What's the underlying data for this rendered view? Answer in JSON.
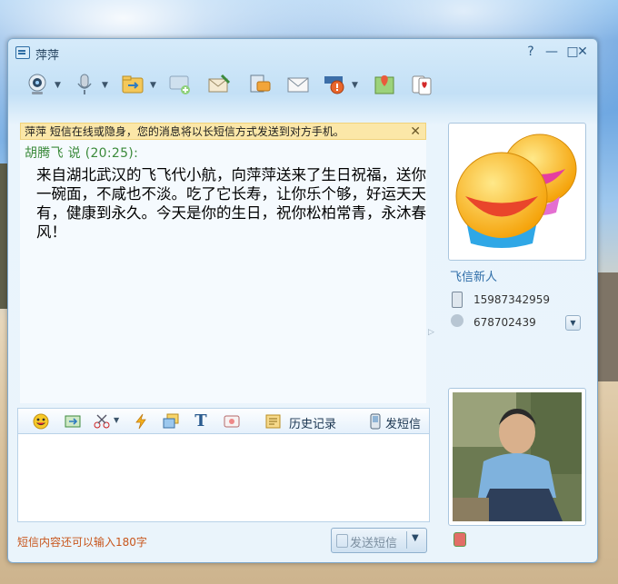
{
  "window": {
    "title": "萍萍",
    "controls": [
      "?",
      "—",
      "□",
      "✕"
    ]
  },
  "toolbar": {
    "buttons": [
      {
        "name": "video",
        "icon": "webcam-icon",
        "has_dropdown": true
      },
      {
        "name": "voice",
        "icon": "microphone-icon",
        "has_dropdown": true
      },
      {
        "name": "send-file",
        "icon": "folder-arrow-icon",
        "has_dropdown": true
      },
      {
        "name": "add-to-group",
        "icon": "chat-add-icon",
        "has_dropdown": false
      },
      {
        "name": "send-email",
        "icon": "envelope-pen-icon",
        "has_dropdown": false
      },
      {
        "name": "message-board",
        "icon": "message-board-icon",
        "has_dropdown": false
      },
      {
        "name": "mail",
        "icon": "mail-icon",
        "has_dropdown": false
      },
      {
        "name": "report",
        "icon": "warning-icon",
        "has_dropdown": true
      },
      {
        "name": "map",
        "icon": "map-pin-icon",
        "has_dropdown": false
      },
      {
        "name": "cards",
        "icon": "playing-cards-icon",
        "has_dropdown": false
      }
    ]
  },
  "notice": {
    "text": "萍萍 短信在线或隐身，您的消息将以长短信方式发送到对方手机。",
    "close": "✕"
  },
  "chat": {
    "message_header": "胡腾飞 说 (20:25):",
    "message_body": "来自湖北武汉的飞飞代小航，向萍萍送来了生日祝福，送你一碗面，不咸也不淡。吃了它长寿，让你乐个够，好运天天有，健康到永久。今天是你的生日，祝你松柏常青，永沐春风！"
  },
  "composer": {
    "history_label": "历史记录",
    "sms_label": "发短信",
    "tools": [
      "smiley-icon",
      "screenshot-icon",
      "scissors-icon",
      "lightning-icon",
      "window-icon",
      "font-icon",
      "magic-icon"
    ]
  },
  "footer": {
    "counter_text": "短信内容还可以输入180字",
    "send_label": "发送短信"
  },
  "contact": {
    "name": "飞信新人",
    "phone": "15987342959",
    "fetion_id": "678702439"
  },
  "colors": {
    "notice_bg": "#fbe7a8",
    "message_header": "#3b8a3b",
    "counter_text": "#c8561c",
    "contact_name": "#2e6da8"
  }
}
